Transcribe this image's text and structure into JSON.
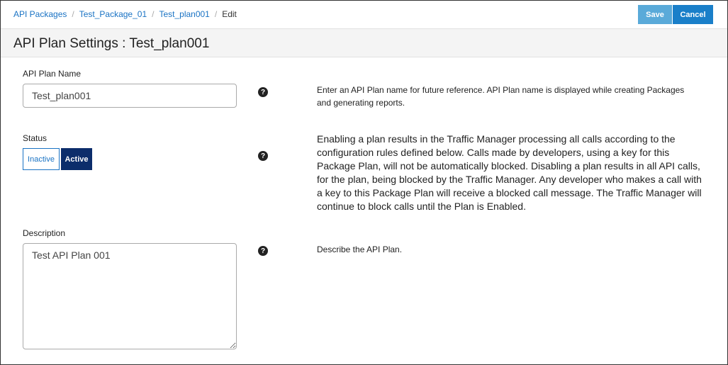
{
  "breadcrumb": {
    "items": [
      "API Packages",
      "Test_Package_01",
      "Test_plan001"
    ],
    "separator": "/",
    "current": "Edit"
  },
  "toolbar": {
    "save_label": "Save",
    "cancel_label": "Cancel"
  },
  "page": {
    "title": "API Plan Settings : Test_plan001"
  },
  "form": {
    "plan_name": {
      "label": "API Plan Name",
      "value": "Test_plan001",
      "help": "Enter an API Plan name for future reference. API Plan name is displayed while creating Packages and generating reports."
    },
    "status": {
      "label": "Status",
      "options": [
        "Inactive",
        "Active"
      ],
      "selected": "Active",
      "help": "Enabling a plan results in the Traffic Manager processing all calls according to the configuration rules defined below. Calls made by developers, using a key for this Package Plan, will not be automatically blocked. Disabling a plan results in all API calls, for the plan, being blocked by the Traffic Manager. Any developer who makes a call with a key to this Package Plan will receive a blocked call message. The Traffic Manager will continue to block calls until the Plan is Enabled."
    },
    "description": {
      "label": "Description",
      "value": "Test API Plan 001",
      "help": "Describe the API Plan."
    }
  },
  "icons": {
    "help": "question-circle-icon",
    "help_glyph": "?"
  },
  "colors": {
    "link": "#1a73c4",
    "save_button": "#5aaad9",
    "cancel_button": "#1a7fc9",
    "active_toggle": "#0c2d6b"
  }
}
